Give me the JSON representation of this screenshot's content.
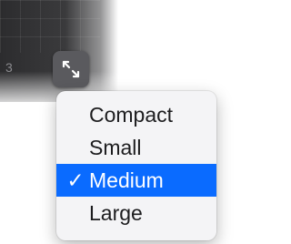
{
  "background": {
    "row_number": "3"
  },
  "resize_button": {
    "icon": "expand-arrows-icon"
  },
  "menu": {
    "check_glyph": "✓",
    "selected_index": 2,
    "items": [
      {
        "label": "Compact"
      },
      {
        "label": "Small"
      },
      {
        "label": "Medium"
      },
      {
        "label": "Large"
      }
    ]
  },
  "colors": {
    "selection": "#0a6bff",
    "menu_background": "#f4f4f6",
    "dark_panel": "#2c2c2e"
  }
}
